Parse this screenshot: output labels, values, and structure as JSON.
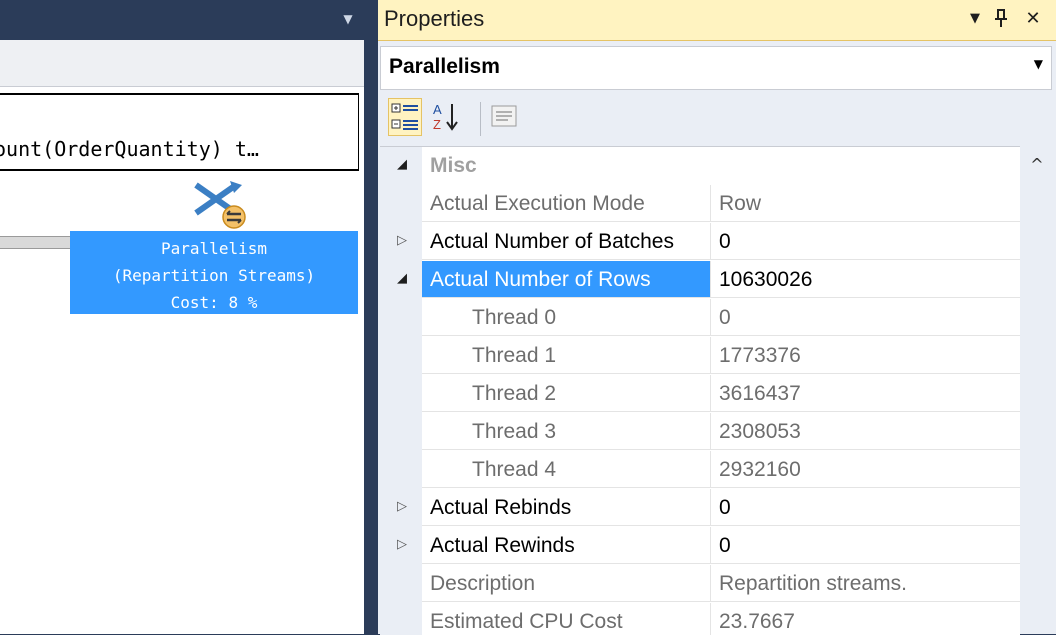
{
  "plan": {
    "query_text": "ount(OrderQuantity) t…",
    "operator": {
      "name": "Parallelism",
      "detail": "(Repartition Streams)",
      "cost": "Cost: 8 %"
    }
  },
  "properties": {
    "title": "Properties",
    "object_name": "Parallelism",
    "rows": [
      {
        "label": "Misc",
        "kind": "category",
        "expander": "◢"
      },
      {
        "label": "Actual Execution Mode",
        "value": "Row",
        "kind": "prop"
      },
      {
        "label": "Actual Number of Batches",
        "value": "0",
        "kind": "expandable",
        "expander": "▷"
      },
      {
        "label": "Actual Number of Rows",
        "value": "10630026",
        "kind": "expanded-selected",
        "expander": "◢"
      },
      {
        "label": "Thread 0",
        "value": "0",
        "kind": "sub"
      },
      {
        "label": "Thread 1",
        "value": "1773376",
        "kind": "sub"
      },
      {
        "label": "Thread 2",
        "value": "3616437",
        "kind": "sub"
      },
      {
        "label": "Thread 3",
        "value": "2308053",
        "kind": "sub"
      },
      {
        "label": "Thread 4",
        "value": "2932160",
        "kind": "sub"
      },
      {
        "label": "Actual Rebinds",
        "value": "0",
        "kind": "expandable",
        "expander": "▷"
      },
      {
        "label": "Actual Rewinds",
        "value": "0",
        "kind": "expandable",
        "expander": "▷"
      },
      {
        "label": "Description",
        "value": "Repartition streams.",
        "kind": "prop"
      },
      {
        "label": "Estimated CPU Cost",
        "value": "23.7667",
        "kind": "prop"
      }
    ]
  },
  "colors": {
    "selection": "#3399ff",
    "titlebar": "#fff3c1",
    "chrome": "#2b3c59"
  },
  "icons": [
    "dropdown-arrow-icon",
    "pin-icon",
    "close-icon",
    "categorized-icon",
    "alphabetical-icon",
    "property-pages-icon",
    "parallelism-operator-icon",
    "scroll-up-icon"
  ]
}
